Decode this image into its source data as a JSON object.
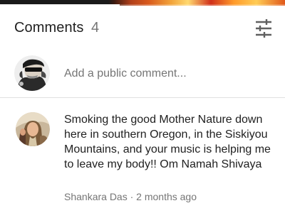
{
  "header": {
    "title": "Comments",
    "count": "4",
    "filter_icon": "tune-icon"
  },
  "video": {
    "progress": 0.42
  },
  "add_comment": {
    "avatar_icon": "avatar-current-user",
    "placeholder": "Add a public comment..."
  },
  "comments": [
    {
      "avatar_icon": "avatar-commenter",
      "text": "Smoking the good Mother Nature down here in southern Oregon, in the Siskiyou Mountains, and your music is helping me to leave my body!! Om Namah Shivaya",
      "author": "Shankara Das",
      "separator": " · ",
      "time": "2 months ago"
    }
  ],
  "colors": {
    "text_primary": "#212121",
    "text_secondary": "#757575",
    "placeholder": "#8a8a8a",
    "divider": "#e0e0e0"
  }
}
